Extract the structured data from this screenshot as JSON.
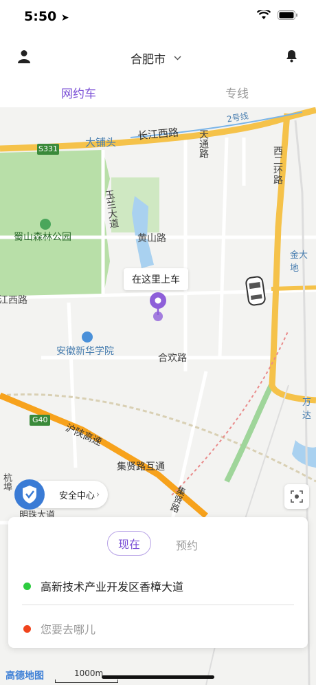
{
  "status_bar": {
    "time": "5:50"
  },
  "header": {
    "city": "合肥市"
  },
  "tabs": [
    {
      "label": "网约车",
      "active": true
    },
    {
      "label": "专线",
      "active": false
    }
  ],
  "map": {
    "labels": {
      "daputou": "大铺头",
      "changjiang": "长江西路",
      "route2": "2号线",
      "s331": "S331",
      "tiantong": "天通路",
      "xierhuan": "西二环路",
      "shushan": "蜀山森林公园",
      "yulan": "玉兰大道",
      "huangshan": "黄山路",
      "jinda": "金大地",
      "xilu": "江西路",
      "anhui": "安徽新华学院",
      "hehuan": "合欢路",
      "wan": "万达",
      "g40": "G40",
      "hushan": "沪陕高速",
      "jixian": "集贤路互通",
      "jixian2": "集贤路",
      "hang": "杭埠",
      "mingzhu": "明珠大道"
    },
    "pickup_label": "在这里上车"
  },
  "safety": {
    "label": "安全中心"
  },
  "card": {
    "segment_now": "现在",
    "segment_later": "预约",
    "from": "高新技术产业开发区香樟大道",
    "to_placeholder": "您要去哪儿"
  },
  "footer": {
    "logo": "高德地图",
    "scale": "1000m"
  },
  "colors": {
    "accent": "#7a4fd6",
    "start": "#2ecc40",
    "end": "#f0441c"
  }
}
